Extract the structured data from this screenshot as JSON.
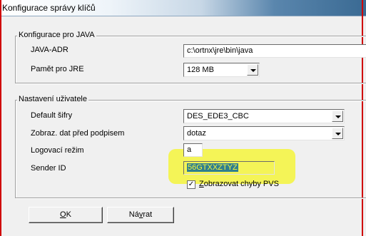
{
  "window": {
    "title": "Konfigurace správy klíčů"
  },
  "java_group": {
    "legend": "Konfigurace pro JAVA",
    "java_adr_label": "JAVA-ADR",
    "java_adr_value": "c:\\ortnx\\jre\\bin\\java",
    "memory_label": "Pamět pro JRE",
    "memory_value": "128 MB"
  },
  "user_group": {
    "legend": "Nastavení uživatele",
    "cipher_label": "Default šifry",
    "cipher_value": "DES_EDE3_CBC",
    "display_label": "Zobraz. dat před podpisem",
    "display_value": "dotaz",
    "log_label": "Logovací režim",
    "log_value": "a",
    "sender_label": "Sender ID",
    "sender_value": "56GTXXZTYZ",
    "show_errors_mnemonic": "Z",
    "show_errors_rest": "obrazovat chyby PVS",
    "show_errors_checked": "✓"
  },
  "buttons": {
    "ok_mnemonic": "O",
    "ok_rest": "K",
    "back_pre": "Ná",
    "back_mnemonic": "v",
    "back_post": "rat"
  }
}
